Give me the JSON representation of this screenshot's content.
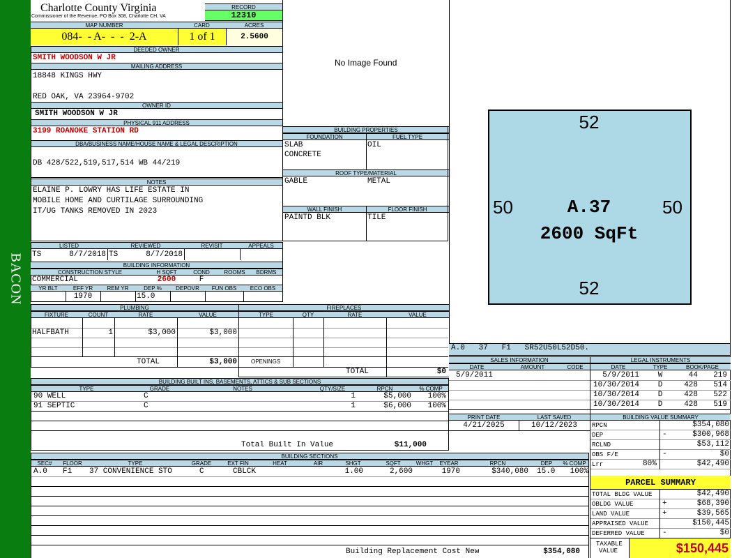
{
  "sidebar": {
    "label": "BACON",
    "color": "#0a7d10"
  },
  "header": {
    "county": "Charlotte County Virginia",
    "office": "Commissioner of the Revenue, PO Box 308, Charlotte CH, VA",
    "record_label": "RECORD",
    "record": "12310",
    "map_label": "MAP NUMBER",
    "map_number": "084-  - A-  -  -  2-A",
    "card_label": "CARD",
    "card": "1 of 1",
    "acres_label": "ACRES",
    "acres": "2.5600"
  },
  "owner": {
    "deeded_label": "DEEDED OWNER",
    "deeded": "SMITH WOODSON W JR",
    "mailing_label": "MAILING ADDRESS",
    "mail1": "18848 KINGS HWY",
    "mail2": "RED OAK, VA 23964-9702",
    "ownerid_label": "OWNER ID",
    "ownerid": "SMITH WOODSON W JR",
    "phys_label": "PHYSICAL 911 ADDRESS",
    "phys": "3199 ROANOKE STATION RD",
    "dba_label": "DBA/BUSINESS NAME/HOUSE NAME & LEGAL DESCRIPTION",
    "dba": "DB 428/522,519,517,514 WB 44/219",
    "notes_label": "NOTES",
    "notes": [
      "ELAINE P. LOWRY HAS LIFE ESTATE IN",
      "MOBILE HOME AND CURTILAGE SURROUNDING",
      "IT/UG TANKS REMOVED IN 2023"
    ]
  },
  "image": {
    "text": "No Image Found"
  },
  "sketch": {
    "top": "52",
    "bottom": "52",
    "left": "50",
    "right": "50",
    "label": "A.37",
    "area": "2600 SqFt",
    "code": "A.0   37   F1   SR52U50L52D50.",
    "fill": "#add8e6"
  },
  "building_props": {
    "title": "BUILDING PROPERTIES",
    "foundation_label": "FOUNDATION",
    "fuel_label": "FUEL TYPE",
    "foundation1": "SLAB",
    "foundation2": "CONCRETE",
    "fuel": "OIL",
    "roof_label": "ROOF TYPE/MATERIAL",
    "roof_type": "GABLE",
    "roof_mat": "METAL",
    "wall_label": "WALL FINISH",
    "floor_label": "FLOOR FINISH",
    "wall": "PAINTD BLK",
    "floor": "TILE"
  },
  "review": {
    "listed_label": "LISTED",
    "reviewed_label": "REVIEWED",
    "revisit_label": "REVISIT",
    "appeals_label": "APPEALS",
    "listed_by": "TS",
    "listed": "8/7/2018",
    "reviewed_by": "TS",
    "reviewed": "8/7/2018"
  },
  "building_info": {
    "title": "BUILDING INFORMATION",
    "style_label": "CONSTRUCTION STYLE",
    "hsqft_label": "H SQFT",
    "cond_label": "COND",
    "rooms_label": "ROOMS",
    "bdrms_label": "BDRMS",
    "style": "COMMERCIAL",
    "hsqft": "2600",
    "cond": "F",
    "yrblt_label": "YR BLT",
    "effyr_label": "EFF YR",
    "remyr_label": "REM YR",
    "dep_label": "DEP %",
    "depovr_label": "DEPOVR",
    "funobs_label": "FUN OBS",
    "ecoobs_label": "ECO OBS",
    "effyr": "1970",
    "dep": "15.0"
  },
  "plumbing": {
    "title": "PLUMBING",
    "cols": [
      "FIXTURE",
      "COUNT",
      "RATE",
      "VALUE"
    ],
    "rows": [
      {
        "fixture": "HALFBATH",
        "count": "1",
        "rate": "$3,000",
        "value": "$3,000"
      }
    ],
    "total_label": "TOTAL",
    "total": "$3,000"
  },
  "fireplaces": {
    "title": "FIREPLACES",
    "cols": [
      "TYPE",
      "QTY",
      "RATE",
      "VALUE"
    ],
    "openings_label": "OPENINGS",
    "total_label": "TOTAL",
    "total": "$0"
  },
  "sales": {
    "title": "SALES INFORMATION",
    "cols": [
      "DATE",
      "AMOUNT",
      "CODE"
    ],
    "rows": [
      {
        "date": "5/9/2011",
        "amount": "",
        "code": ""
      }
    ]
  },
  "legal": {
    "title": "LEGAL INSTRUMENTS",
    "cols": [
      "DATE",
      "TYPE",
      "BOOK/PAGE"
    ],
    "rows": [
      {
        "date": "5/9/2011",
        "type": "W",
        "book": "44",
        "page": "219"
      },
      {
        "date": "10/30/2014",
        "type": "D",
        "book": "428",
        "page": "514"
      },
      {
        "date": "10/30/2014",
        "type": "D",
        "book": "428",
        "page": "522"
      },
      {
        "date": "10/30/2014",
        "type": "D",
        "book": "428",
        "page": "519"
      }
    ]
  },
  "print": {
    "print_label": "PRINT DATE",
    "saved_label": "LAST SAVED",
    "print_date": "4/21/2025",
    "saved": "10/12/2023"
  },
  "bvs": {
    "title": "BUILDING VALUE SUMMARY",
    "rows": [
      {
        "label": "RPCN",
        "sign": "",
        "value": "$354,080"
      },
      {
        "label": "DEP",
        "sign": "-",
        "value": "$300,968"
      },
      {
        "label": "RCLND",
        "sign": "",
        "value": "$53,112"
      },
      {
        "label": "OBS F/E",
        "sign": "-",
        "value": "$0"
      },
      {
        "label": "Lrr",
        "sign": "80%",
        "value": "$42,490"
      }
    ]
  },
  "builtins": {
    "title": "BUILDING BUILT INS, BASEMENTS, ATTICS & SUB SECTIONS",
    "cols": [
      "TYPE",
      "GRADE",
      "NOTES",
      "QTY/SIZE",
      "RPCN",
      "% COMP"
    ],
    "rows": [
      {
        "type": "90 WELL",
        "grade": "C",
        "notes": "",
        "qty": "1",
        "rpcn": "$5,000",
        "comp": "100%"
      },
      {
        "type": "91 SEPTIC",
        "grade": "C",
        "notes": "",
        "qty": "1",
        "rpcn": "$6,000",
        "comp": "100%"
      }
    ],
    "total_label": "Total Built In Value",
    "total": "$11,000"
  },
  "sections": {
    "title": "BUILDING SECTIONS",
    "cols": [
      "SEC#",
      "FLOOR",
      "TYPE",
      "GRADE",
      "EXT FIN",
      "HEAT",
      "AIR",
      "SHGT",
      "SQFT",
      "WHGT",
      "EYEAR",
      "RPCN",
      "DEP",
      "% COMP"
    ],
    "rows": [
      {
        "sec": "A.0",
        "floor": "F1",
        "type": "37 CONVENIENCE STO",
        "grade": "C",
        "ext": "CBLCK",
        "heat": "",
        "air": "",
        "shgt": "1.00",
        "sqft": "2,600",
        "whgt": "",
        "eyear": "1970",
        "rpcn": "$340,080",
        "dep": "15.0",
        "comp": "100%"
      }
    ],
    "brcn_label": "Building Replacement Cost New",
    "brcn": "$354,080"
  },
  "parcel": {
    "title": "PARCEL SUMMARY",
    "rows": [
      {
        "label": "TOTAL BLDG VALUE",
        "sign": "",
        "value": "$42,490"
      },
      {
        "label": "OBLDG VALUE",
        "sign": "+",
        "value": "$68,390"
      },
      {
        "label": "LAND VALUE",
        "sign": "+",
        "value": "$39,565"
      },
      {
        "label": "APPRAISED VALUE",
        "sign": "",
        "value": "$150,445"
      },
      {
        "label": "DEFERRED VALUE",
        "sign": "-",
        "value": "$0"
      }
    ],
    "taxable_label1": "TAXABLE",
    "taxable_label2": "VALUE",
    "taxable": "$150,445",
    "accent": "#ffff33"
  }
}
